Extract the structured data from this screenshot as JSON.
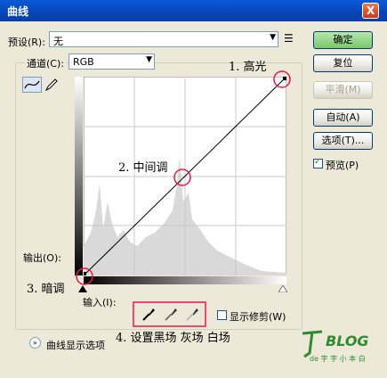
{
  "window": {
    "title": "曲线",
    "close_glyph": "X"
  },
  "preset": {
    "label": "预设(R):",
    "value": "无",
    "menu_icon": "menu-list-icon"
  },
  "channel": {
    "label": "通道(C):",
    "value": "RGB"
  },
  "buttons": {
    "ok": "确定",
    "reset": "复位",
    "smooth": "平滑(M)",
    "auto": "自动(A)",
    "options": "选项(T)...",
    "preview": "预览(P)"
  },
  "graph": {
    "output_label": "输出(O):",
    "input_label": "输入(I):"
  },
  "tools": {
    "show_clipping": "显示修剪(W)",
    "curve_display": "曲线显示选项",
    "eyedroppers": [
      "black-eyedropper-icon",
      "gray-eyedropper-icon",
      "white-eyedropper-icon"
    ]
  },
  "annotations": {
    "highlight": "1. 高光",
    "midtone": "2. 中间调",
    "shadow": "3. 暗调",
    "eyedrop": "4. 设置黑场  灰场  白场"
  },
  "watermark": {
    "text": "BLOG",
    "sub": "de 字 字 小 本 白"
  },
  "colors": {
    "accent_circle": "#e8184a",
    "titlebar": "#0a4fc8"
  }
}
